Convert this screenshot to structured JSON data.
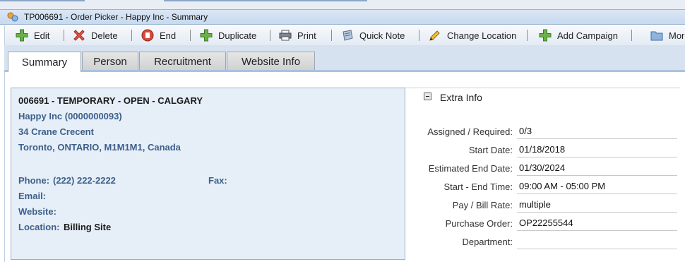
{
  "window": {
    "title": "TP006691 - Order Picker - Happy Inc - Summary"
  },
  "toolbar": {
    "buttons": [
      {
        "label": "Edit",
        "icon": "plus-icon"
      },
      {
        "label": "Delete",
        "icon": "delete-x-icon"
      },
      {
        "label": "End",
        "icon": "end-icon"
      },
      {
        "label": "Duplicate",
        "icon": "plus-icon"
      },
      {
        "label": "Print",
        "icon": "printer-icon"
      },
      {
        "label": "Quick Note",
        "icon": "note-icon"
      },
      {
        "label": "Change Location",
        "icon": "pencil-icon"
      },
      {
        "label": "Add Campaign",
        "icon": "plus-icon"
      },
      {
        "label": "More",
        "icon": "folder-icon"
      }
    ]
  },
  "tabs": [
    {
      "label": "Summary",
      "active": true
    },
    {
      "label": "Person",
      "active": false
    },
    {
      "label": "Recruitment",
      "active": false
    },
    {
      "label": "Website Info",
      "active": false
    }
  ],
  "summary": {
    "heading": "006691 - TEMPORARY - OPEN - CALGARY",
    "company": "Happy Inc (0000000093)",
    "street": "34 Crane Crecent",
    "city_line": "Toronto, ONTARIO, M1M1M1, Canada",
    "phone_label": "Phone:",
    "phone_value": "(222) 222-2222",
    "fax_label": "Fax:",
    "fax_value": "",
    "email_label": "Email:",
    "email_value": "",
    "website_label": "Website:",
    "website_value": "",
    "location_label": "Location:",
    "location_value": "Billing Site"
  },
  "extra_info": {
    "title": "Extra Info",
    "fields": [
      {
        "label": "Assigned / Required:",
        "value": "0/3"
      },
      {
        "label": "Start Date:",
        "value": "01/18/2018"
      },
      {
        "label": "Estimated End Date:",
        "value": "01/30/2024"
      },
      {
        "label": "Start - End Time:",
        "value": "09:00 AM - 05:00 PM"
      },
      {
        "label": "Pay / Bill Rate:",
        "value": "multiple"
      },
      {
        "label": "Purchase Order:",
        "value": "OP22255544"
      },
      {
        "label": "Department:",
        "value": ""
      }
    ]
  },
  "colors": {
    "accent_blue": "#3d5f8a",
    "panel_bg": "#e6eef8",
    "tab_strip": "#d6e2f0"
  }
}
